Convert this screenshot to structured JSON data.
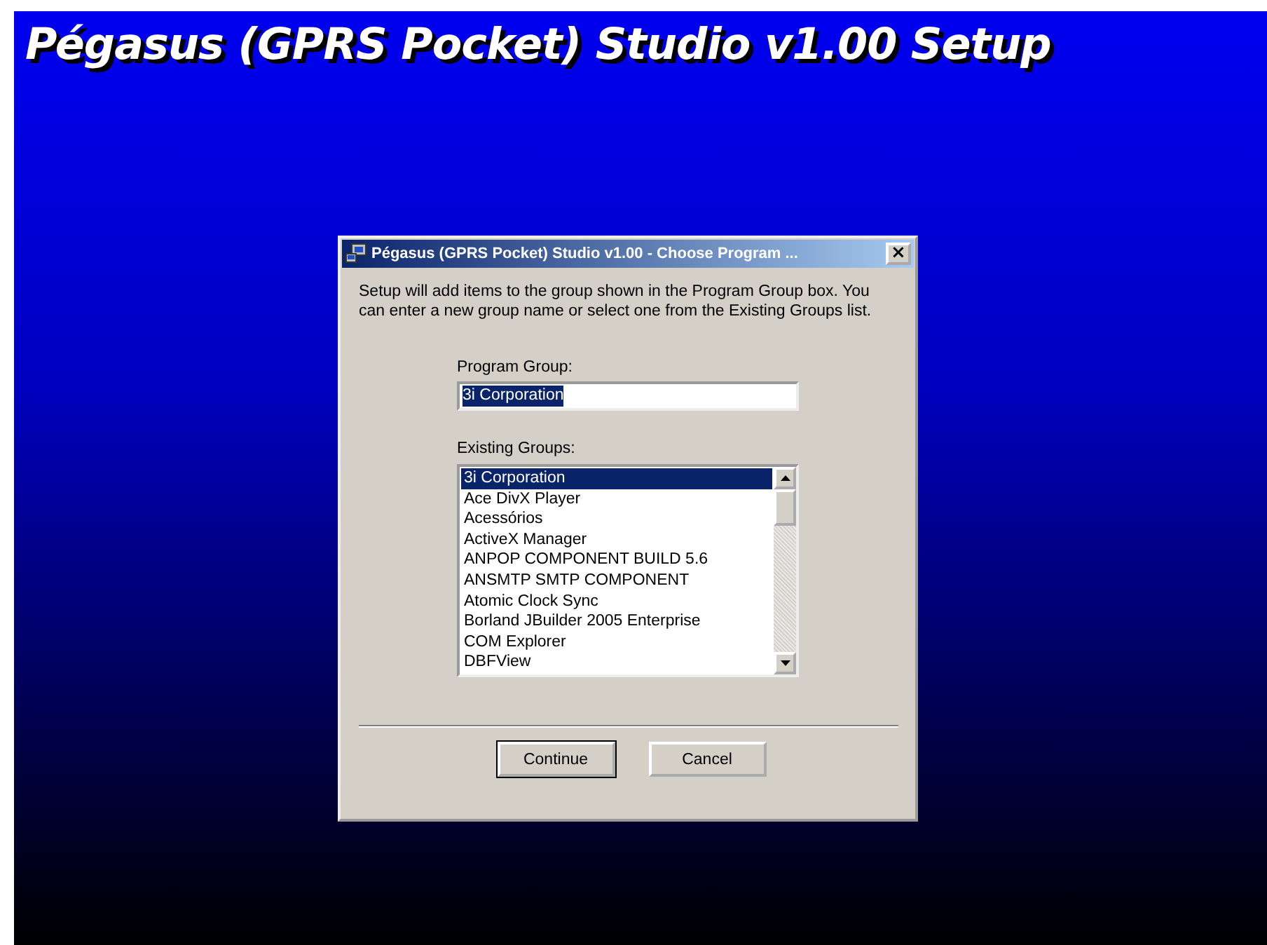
{
  "banner": {
    "title": "Pégasus (GPRS Pocket) Studio v1.00 Setup"
  },
  "dialog": {
    "title": "Pégasus (GPRS Pocket) Studio v1.00 - Choose Program ...",
    "close": "×",
    "intro": "Setup will add items to the group shown in the Program Group box. You can enter a new group name or select one from the Existing Groups list.",
    "program_group": {
      "label": "Program Group:",
      "value": "3i Corporation"
    },
    "existing_groups": {
      "label": "Existing Groups:",
      "items": [
        {
          "label": "3i Corporation",
          "selected": true
        },
        {
          "label": "Ace DivX Player",
          "selected": false
        },
        {
          "label": "Acessórios",
          "selected": false
        },
        {
          "label": "ActiveX Manager",
          "selected": false
        },
        {
          "label": "ANPOP COMPONENT BUILD 5.6",
          "selected": false
        },
        {
          "label": "ANSMTP SMTP COMPONENT",
          "selected": false
        },
        {
          "label": "Atomic Clock Sync",
          "selected": false
        },
        {
          "label": "Borland JBuilder 2005 Enterprise",
          "selected": false
        },
        {
          "label": "COM Explorer",
          "selected": false
        },
        {
          "label": "DBFView",
          "selected": false
        }
      ]
    },
    "buttons": [
      {
        "label": "Continue",
        "default": true
      },
      {
        "label": "Cancel",
        "default": false
      }
    ]
  }
}
